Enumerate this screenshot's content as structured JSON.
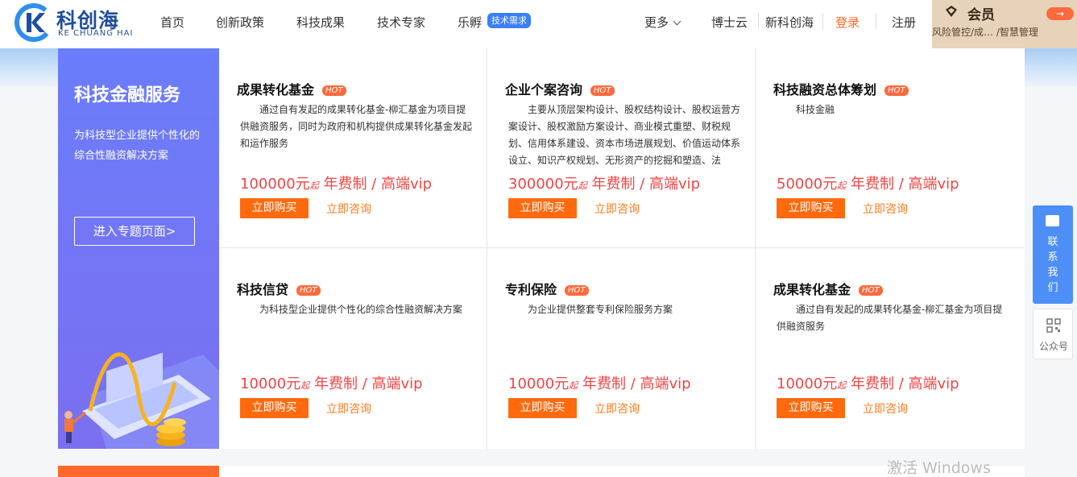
{
  "logo": {
    "cn": "科创海",
    "en": "KE CHUANG HAI"
  },
  "nav": {
    "items": [
      "首页",
      "创新政策",
      "科技成果",
      "技术专家",
      "乐孵"
    ],
    "badge": "技术需求",
    "more": "更多",
    "links": [
      "博士云",
      "新科创海"
    ],
    "login": "登录",
    "register": "注册"
  },
  "member": {
    "title": "会员",
    "sub": "风险管控/成…  /智慧管理",
    "arrow": "→"
  },
  "banner": {
    "title": "科技金融服务",
    "desc": "为科技型企业提供个性化的综合性融资解决方案",
    "button": "进入专题页面>"
  },
  "cards": [
    {
      "title": "成果转化基金",
      "hot": "HOT",
      "desc": "通过自有发起的成果转化基金-柳汇基金为项目提供融资服务，同时为政府和机构提供成果转化基金发起和运作服务",
      "price": "100000元",
      "qi": "起",
      "suffix": " 年费制 / 高端vip",
      "buy": "立即购买",
      "consult": "立即咨询"
    },
    {
      "title": "企业个案咨询",
      "hot": "HOT",
      "desc": "主要从顶层架构设计、股权结构设计、股权运营方案设计、股权激励方案设计、商业模式重塑、财税规划、信用体系建设、资本市场进展规划、价值运动体系设立、知识产权规划、无形资产的挖掘和塑造、法",
      "price": "300000元",
      "qi": "起",
      "suffix": " 年费制 / 高端vip",
      "buy": "立即购买",
      "consult": "立即咨询"
    },
    {
      "title": "科技融资总体筹划",
      "hot": "HOT",
      "desc": "科技金融",
      "price": "50000元",
      "qi": "起",
      "suffix": " 年费制 / 高端vip",
      "buy": "立即购买",
      "consult": "立即咨询"
    },
    {
      "title": "科技信贷",
      "hot": "HOT",
      "desc": "为科技型企业提供个性化的综合性融资解决方案",
      "price": "10000元",
      "qi": "起",
      "suffix": " 年费制 / 高端vip",
      "buy": "立即购买",
      "consult": "立即咨询"
    },
    {
      "title": "专利保险",
      "hot": "HOT",
      "desc": "为企业提供整套专利保险服务方案",
      "price": "10000元",
      "qi": "起",
      "suffix": " 年费制 / 高端vip",
      "buy": "立即购买",
      "consult": "立即咨询"
    },
    {
      "title": "成果转化基金",
      "hot": "HOT",
      "desc": "通过自有发起的成果转化基金-柳汇基金为项目提供融资服务",
      "price": "10000元",
      "qi": "起",
      "suffix": " 年费制 / 高端vip",
      "buy": "立即购买",
      "consult": "立即咨询"
    }
  ],
  "float": {
    "contact": "联系我们",
    "qr": "公众号"
  },
  "watermark": "激活 Windows"
}
